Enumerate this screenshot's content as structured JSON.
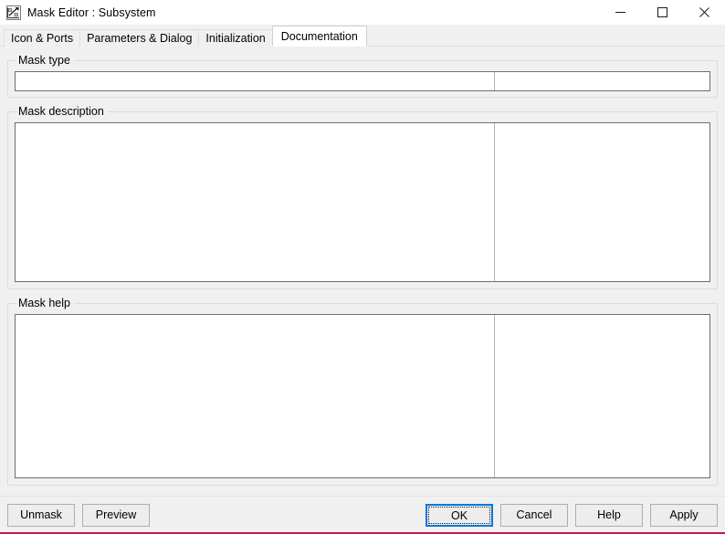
{
  "window": {
    "title": "Mask Editor : Subsystem",
    "icon": "mask-editor-icon",
    "minimize_label": "–",
    "maximize_label": "□",
    "close_label": "✕",
    "accent_color": "#c2185b"
  },
  "tabs": [
    {
      "id": "icon-ports",
      "label": "Icon & Ports",
      "active": false
    },
    {
      "id": "parameters-dialog",
      "label": "Parameters & Dialog",
      "active": false
    },
    {
      "id": "initialization",
      "label": "Initialization",
      "active": false
    },
    {
      "id": "documentation",
      "label": "Documentation",
      "active": true
    }
  ],
  "sections": {
    "mask_type": {
      "label": "Mask type",
      "value": "",
      "placeholder": ""
    },
    "mask_description": {
      "label": "Mask description",
      "value": "",
      "placeholder": ""
    },
    "mask_help": {
      "label": "Mask help",
      "value": "",
      "placeholder": ""
    }
  },
  "buttons": {
    "unmask": "Unmask",
    "preview": "Preview",
    "ok": "OK",
    "cancel": "Cancel",
    "help": "Help",
    "apply": "Apply"
  }
}
